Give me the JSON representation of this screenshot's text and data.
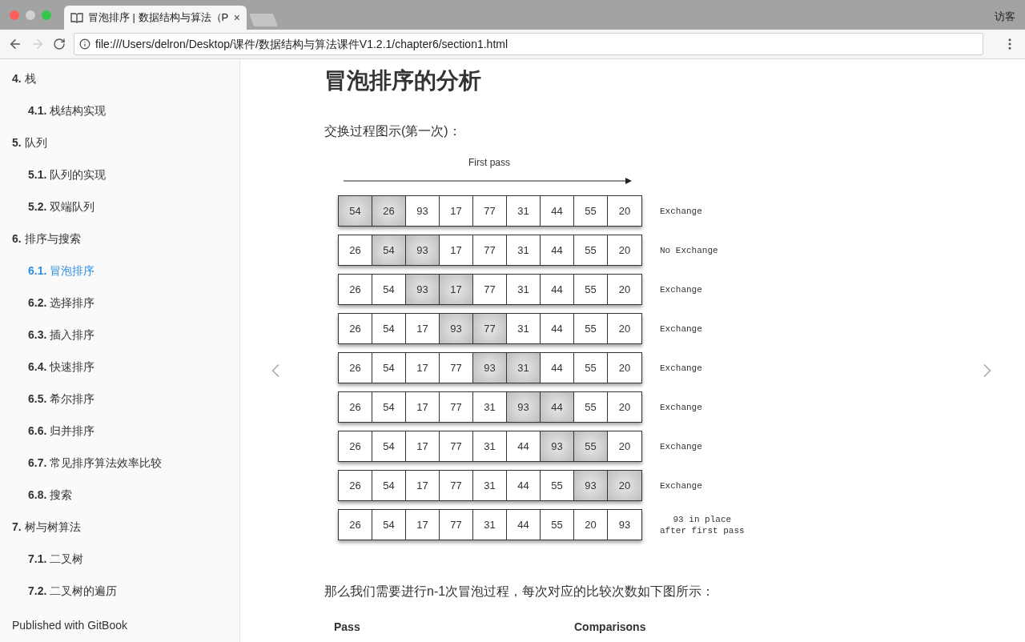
{
  "browser": {
    "tab": {
      "title": "冒泡排序 | 数据结构与算法（P",
      "close": "×"
    },
    "profile": "访客",
    "forward_disabled": true,
    "url": "file:///Users/delron/Desktop/课件/数据结构与算法课件V1.2.1/chapter6/section1.html"
  },
  "sidebar": {
    "items": [
      {
        "number": "4.",
        "label": "栈",
        "selected": false,
        "children": [
          {
            "number": "4.1.",
            "label": "栈结构实现",
            "selected": false
          }
        ]
      },
      {
        "number": "5.",
        "label": "队列",
        "selected": false,
        "children": [
          {
            "number": "5.1.",
            "label": "队列的实现",
            "selected": false
          },
          {
            "number": "5.2.",
            "label": "双端队列",
            "selected": false
          }
        ]
      },
      {
        "number": "6.",
        "label": "排序与搜索",
        "selected": false,
        "children": [
          {
            "number": "6.1.",
            "label": "冒泡排序",
            "selected": true
          },
          {
            "number": "6.2.",
            "label": "选择排序",
            "selected": false
          },
          {
            "number": "6.3.",
            "label": "插入排序",
            "selected": false
          },
          {
            "number": "6.4.",
            "label": "快速排序",
            "selected": false
          },
          {
            "number": "6.5.",
            "label": "希尔排序",
            "selected": false
          },
          {
            "number": "6.6.",
            "label": "归并排序",
            "selected": false
          },
          {
            "number": "6.7.",
            "label": "常见排序算法效率比较",
            "selected": false
          },
          {
            "number": "6.8.",
            "label": "搜索",
            "selected": false
          }
        ]
      },
      {
        "number": "7.",
        "label": "树与树算法",
        "selected": false,
        "children": [
          {
            "number": "7.1.",
            "label": "二叉树",
            "selected": false
          },
          {
            "number": "7.2.",
            "label": "二叉树的遍历",
            "selected": false
          }
        ]
      }
    ],
    "footer": "Published with GitBook"
  },
  "page": {
    "heading": "冒泡排序的分析",
    "intro": "交换过程图示(第一次)：",
    "diagram": {
      "title": "First pass",
      "rows": [
        {
          "cells": [
            {
              "value": "54",
              "highlighted": true
            },
            {
              "value": "26",
              "highlighted": true
            },
            {
              "value": "93",
              "highlighted": false
            },
            {
              "value": "17",
              "highlighted": false
            },
            {
              "value": "77",
              "highlighted": false
            },
            {
              "value": "31",
              "highlighted": false
            },
            {
              "value": "44",
              "highlighted": false
            },
            {
              "value": "55",
              "highlighted": false
            },
            {
              "value": "20",
              "highlighted": false
            }
          ],
          "note": [
            "Exchange"
          ]
        },
        {
          "cells": [
            {
              "value": "26",
              "highlighted": false
            },
            {
              "value": "54",
              "highlighted": true
            },
            {
              "value": "93",
              "highlighted": true
            },
            {
              "value": "17",
              "highlighted": false
            },
            {
              "value": "77",
              "highlighted": false
            },
            {
              "value": "31",
              "highlighted": false
            },
            {
              "value": "44",
              "highlighted": false
            },
            {
              "value": "55",
              "highlighted": false
            },
            {
              "value": "20",
              "highlighted": false
            }
          ],
          "note": [
            "No Exchange"
          ]
        },
        {
          "cells": [
            {
              "value": "26",
              "highlighted": false
            },
            {
              "value": "54",
              "highlighted": false
            },
            {
              "value": "93",
              "highlighted": true
            },
            {
              "value": "17",
              "highlighted": true
            },
            {
              "value": "77",
              "highlighted": false
            },
            {
              "value": "31",
              "highlighted": false
            },
            {
              "value": "44",
              "highlighted": false
            },
            {
              "value": "55",
              "highlighted": false
            },
            {
              "value": "20",
              "highlighted": false
            }
          ],
          "note": [
            "Exchange"
          ]
        },
        {
          "cells": [
            {
              "value": "26",
              "highlighted": false
            },
            {
              "value": "54",
              "highlighted": false
            },
            {
              "value": "17",
              "highlighted": false
            },
            {
              "value": "93",
              "highlighted": true
            },
            {
              "value": "77",
              "highlighted": true
            },
            {
              "value": "31",
              "highlighted": false
            },
            {
              "value": "44",
              "highlighted": false
            },
            {
              "value": "55",
              "highlighted": false
            },
            {
              "value": "20",
              "highlighted": false
            }
          ],
          "note": [
            "Exchange"
          ]
        },
        {
          "cells": [
            {
              "value": "26",
              "highlighted": false
            },
            {
              "value": "54",
              "highlighted": false
            },
            {
              "value": "17",
              "highlighted": false
            },
            {
              "value": "77",
              "highlighted": false
            },
            {
              "value": "93",
              "highlighted": true
            },
            {
              "value": "31",
              "highlighted": true
            },
            {
              "value": "44",
              "highlighted": false
            },
            {
              "value": "55",
              "highlighted": false
            },
            {
              "value": "20",
              "highlighted": false
            }
          ],
          "note": [
            "Exchange"
          ]
        },
        {
          "cells": [
            {
              "value": "26",
              "highlighted": false
            },
            {
              "value": "54",
              "highlighted": false
            },
            {
              "value": "17",
              "highlighted": false
            },
            {
              "value": "77",
              "highlighted": false
            },
            {
              "value": "31",
              "highlighted": false
            },
            {
              "value": "93",
              "highlighted": true
            },
            {
              "value": "44",
              "highlighted": true
            },
            {
              "value": "55",
              "highlighted": false
            },
            {
              "value": "20",
              "highlighted": false
            }
          ],
          "note": [
            "Exchange"
          ]
        },
        {
          "cells": [
            {
              "value": "26",
              "highlighted": false
            },
            {
              "value": "54",
              "highlighted": false
            },
            {
              "value": "17",
              "highlighted": false
            },
            {
              "value": "77",
              "highlighted": false
            },
            {
              "value": "31",
              "highlighted": false
            },
            {
              "value": "44",
              "highlighted": false
            },
            {
              "value": "93",
              "highlighted": true
            },
            {
              "value": "55",
              "highlighted": true
            },
            {
              "value": "20",
              "highlighted": false
            }
          ],
          "note": [
            "Exchange"
          ]
        },
        {
          "cells": [
            {
              "value": "26",
              "highlighted": false
            },
            {
              "value": "54",
              "highlighted": false
            },
            {
              "value": "17",
              "highlighted": false
            },
            {
              "value": "77",
              "highlighted": false
            },
            {
              "value": "31",
              "highlighted": false
            },
            {
              "value": "44",
              "highlighted": false
            },
            {
              "value": "55",
              "highlighted": false
            },
            {
              "value": "93",
              "highlighted": true
            },
            {
              "value": "20",
              "highlighted": true
            }
          ],
          "note": [
            "Exchange"
          ]
        },
        {
          "cells": [
            {
              "value": "26",
              "highlighted": false
            },
            {
              "value": "54",
              "highlighted": false
            },
            {
              "value": "17",
              "highlighted": false
            },
            {
              "value": "77",
              "highlighted": false
            },
            {
              "value": "31",
              "highlighted": false
            },
            {
              "value": "44",
              "highlighted": false
            },
            {
              "value": "55",
              "highlighted": false
            },
            {
              "value": "20",
              "highlighted": false
            },
            {
              "value": "93",
              "highlighted": false
            }
          ],
          "note": [
            "93 in place",
            "after first pass"
          ]
        }
      ]
    },
    "outro": "那么我们需要进行n-1次冒泡过程，每次对应的比较次数如下图所示：",
    "table": {
      "columns": [
        "Pass",
        "Comparisons"
      ]
    }
  }
}
